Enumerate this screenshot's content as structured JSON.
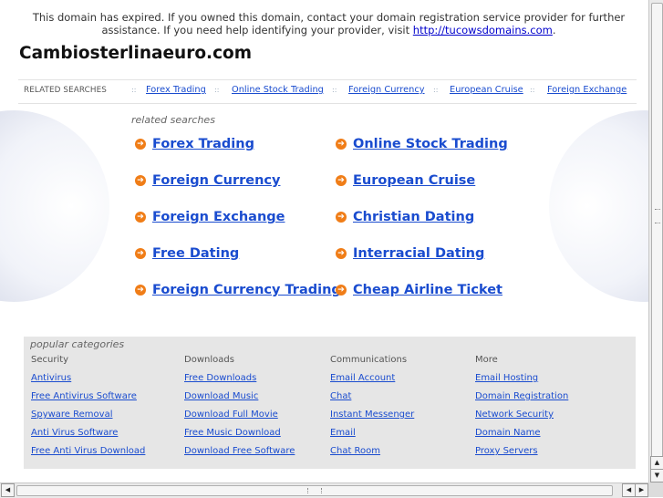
{
  "notice": {
    "text": "This domain has expired. If you owned this domain, contact your domain registration service provider for further assistance. If you need help identifying your provider, visit ",
    "link": "http://tucowsdomains.com",
    "end": "."
  },
  "site_title": "Cambiosterlinaeuro.com",
  "related_bar": {
    "label": "RELATED SEARCHES",
    "separator": "::",
    "items": [
      "Forex Trading",
      "Online Stock Trading",
      "Foreign Currency",
      "European Cruise",
      "Foreign Exchange"
    ]
  },
  "related_heading": "related searches",
  "main_links": {
    "arrow": "➔",
    "left": [
      "Forex Trading",
      "Foreign Currency",
      "Foreign Exchange",
      "Free Dating",
      "Foreign Currency Trading"
    ],
    "right": [
      "Online Stock Trading",
      "European Cruise",
      "Christian Dating",
      "Interracial Dating",
      "Cheap Airline Ticket"
    ]
  },
  "popular": {
    "title": "popular categories",
    "columns": [
      {
        "heading": "Security",
        "links": [
          "Antivirus",
          "Free Antivirus Software",
          "Spyware Removal",
          "Anti Virus Software",
          "Free Anti Virus Download"
        ]
      },
      {
        "heading": "Downloads",
        "links": [
          "Free Downloads",
          "Download Music",
          "Download Full Movie",
          "Free Music Download",
          "Download Free Software"
        ]
      },
      {
        "heading": "Communications",
        "links": [
          "Email Account",
          "Chat",
          "Instant Messenger",
          "Email",
          "Chat Room"
        ]
      },
      {
        "heading": "More",
        "links": [
          "Email Hosting",
          "Domain Registration",
          "Network Security",
          "Domain Name",
          "Proxy Servers"
        ]
      }
    ]
  },
  "scrollbar": {
    "up": "▲",
    "down": "▼",
    "left": "◀",
    "right": "▶"
  },
  "colors": {
    "link": "#1a4ccf",
    "arrow_bullet": "#f07d17",
    "popular_bg": "#e6e6e6"
  }
}
